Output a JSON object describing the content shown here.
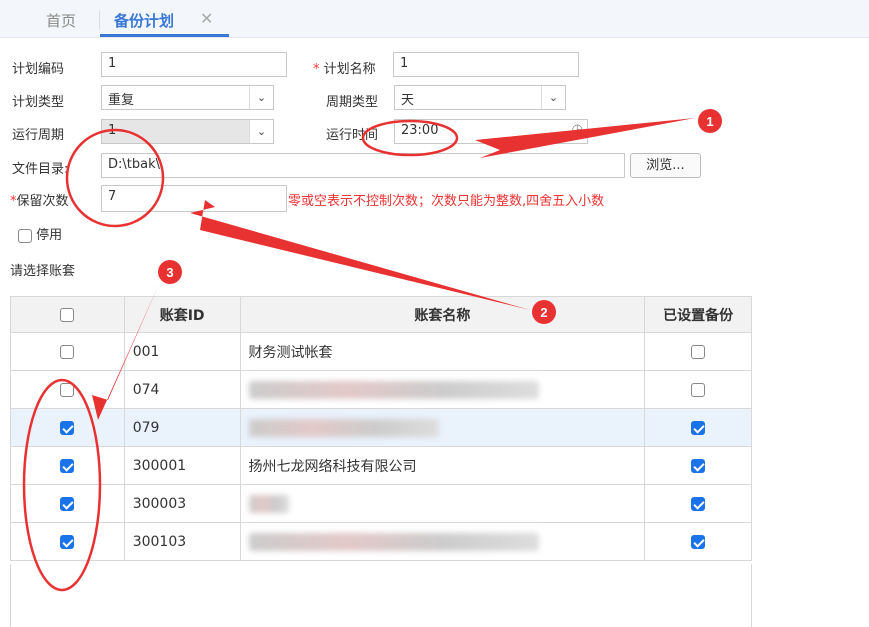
{
  "tabs": {
    "home": "首页",
    "active": "备份计划",
    "close": "✕"
  },
  "form": {
    "plan_code_label": "计划编码",
    "plan_code": "1",
    "plan_name_req": "*",
    "plan_name_label": "计划名称",
    "plan_name": "1",
    "plan_type_label": "计划类型",
    "plan_type": "重复",
    "cycle_type_label": "周期类型",
    "cycle_type": "天",
    "run_cycle_label": "运行周期",
    "run_cycle": "1",
    "run_time_label": "运行时间",
    "run_time": "23:00",
    "dir_label": "文件目录:",
    "dir": "D:\\tbak\\",
    "browse": "浏览...",
    "keep_req": "*",
    "keep_label": "保留次数",
    "keep": "7",
    "keep_hint": "零或空表示不控制次数；次数只能为整数,四舍五入小数",
    "disable_label": "停用",
    "disable_checked": false
  },
  "select_label": "请选择账套",
  "table": {
    "headers": [
      "账套ID",
      "账套名称",
      "已设置备份"
    ],
    "rows": [
      {
        "checked": false,
        "id": "001",
        "name": "财务测试帐套",
        "backup": false
      },
      {
        "checked": false,
        "id": "074",
        "name": "",
        "backup": false
      },
      {
        "checked": true,
        "id": "079",
        "name": "",
        "backup": true
      },
      {
        "checked": true,
        "id": "300001",
        "name": "扬州七龙网络科技有限公司",
        "backup": true
      },
      {
        "checked": true,
        "id": "300003",
        "name": "",
        "backup": true
      },
      {
        "checked": true,
        "id": "300103",
        "name": "",
        "backup": true
      }
    ]
  },
  "annotations": [
    "1",
    "2",
    "3"
  ],
  "colors": {
    "accent": "#3a78d6",
    "annotation": "#e83232",
    "check": "#1a73e8"
  }
}
